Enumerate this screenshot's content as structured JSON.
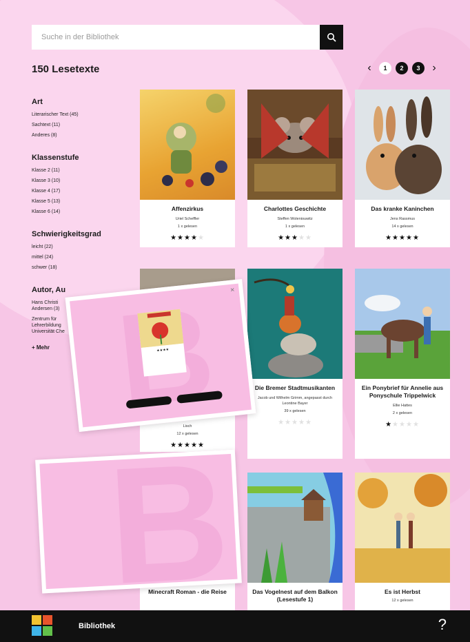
{
  "search": {
    "placeholder": "Suche in der Bibliothek",
    "icon": "search-icon"
  },
  "result_count": "150 Lesetexte",
  "pagination": {
    "prev": "‹",
    "next": "›",
    "pages": [
      "1",
      "2",
      "3"
    ],
    "current": "1"
  },
  "filters": [
    {
      "title": "Art",
      "options": [
        "Literarischer Text (45)",
        "Sachtext (11)",
        "Anderes (8)"
      ]
    },
    {
      "title": "Klassenstufe",
      "options": [
        "Klasse 2 (11)",
        "Klasse 3 (10)",
        "Klasse 4 (17)",
        "Klasse 5 (13)",
        "Klasse 6 (14)"
      ]
    },
    {
      "title": "Schwierigkeitsgrad",
      "options": [
        "leicht (22)",
        "mittel (24)",
        "schwer (18)"
      ]
    },
    {
      "title": "Autor, Au",
      "options": [
        "Hans Christi Andersen (3)",
        "Zentrum für Lehrerbildung Universität Che"
      ]
    }
  ],
  "more_label": "+ Mehr",
  "books": [
    {
      "title": "Affenzirkus",
      "author": "Uriel Scheffler",
      "reads": "1 x gelesen",
      "rating": 4
    },
    {
      "title": "Charlottes Geschichte",
      "author": "Steffen Woleniouwitz",
      "reads": "1 x gelesen",
      "rating": 3
    },
    {
      "title": "Das kranke Kaninchen",
      "author": "Jens Rassmus",
      "reads": "14 x gelesen",
      "rating": 5
    },
    {
      "title": "",
      "author": "Lisch",
      "reads": "12 x gelesen",
      "rating": 5
    },
    {
      "title": "Die Bremer Stadtmusikanten",
      "author": "Jacob und Wilhelm Grimm, angepasst durch Leontine Bayer",
      "reads": "39 x gelesen",
      "rating": 0
    },
    {
      "title": "Ein Ponybrief für Annelie aus Ponyschule Trippelwick",
      "author": "Ellie Hattes",
      "reads": "2 x gelesen",
      "rating": 1
    },
    {
      "title": "Minecraft Roman - die Reise",
      "author": "",
      "reads": "",
      "rating": 0
    },
    {
      "title": "Das Vogelnest auf dem Balkon (Lesestufe 1)",
      "author": "",
      "reads": "",
      "rating": 0
    },
    {
      "title": "Es ist Herbst",
      "author": "",
      "reads": "12 x gelesen",
      "rating": 0
    }
  ],
  "bottom_nav": {
    "label": "Bibliothek",
    "help": "?"
  },
  "colors": {
    "background": "#f7c6e6",
    "accent": "#111111",
    "star_on": "#111111",
    "star_off": "#e1e1e1"
  }
}
